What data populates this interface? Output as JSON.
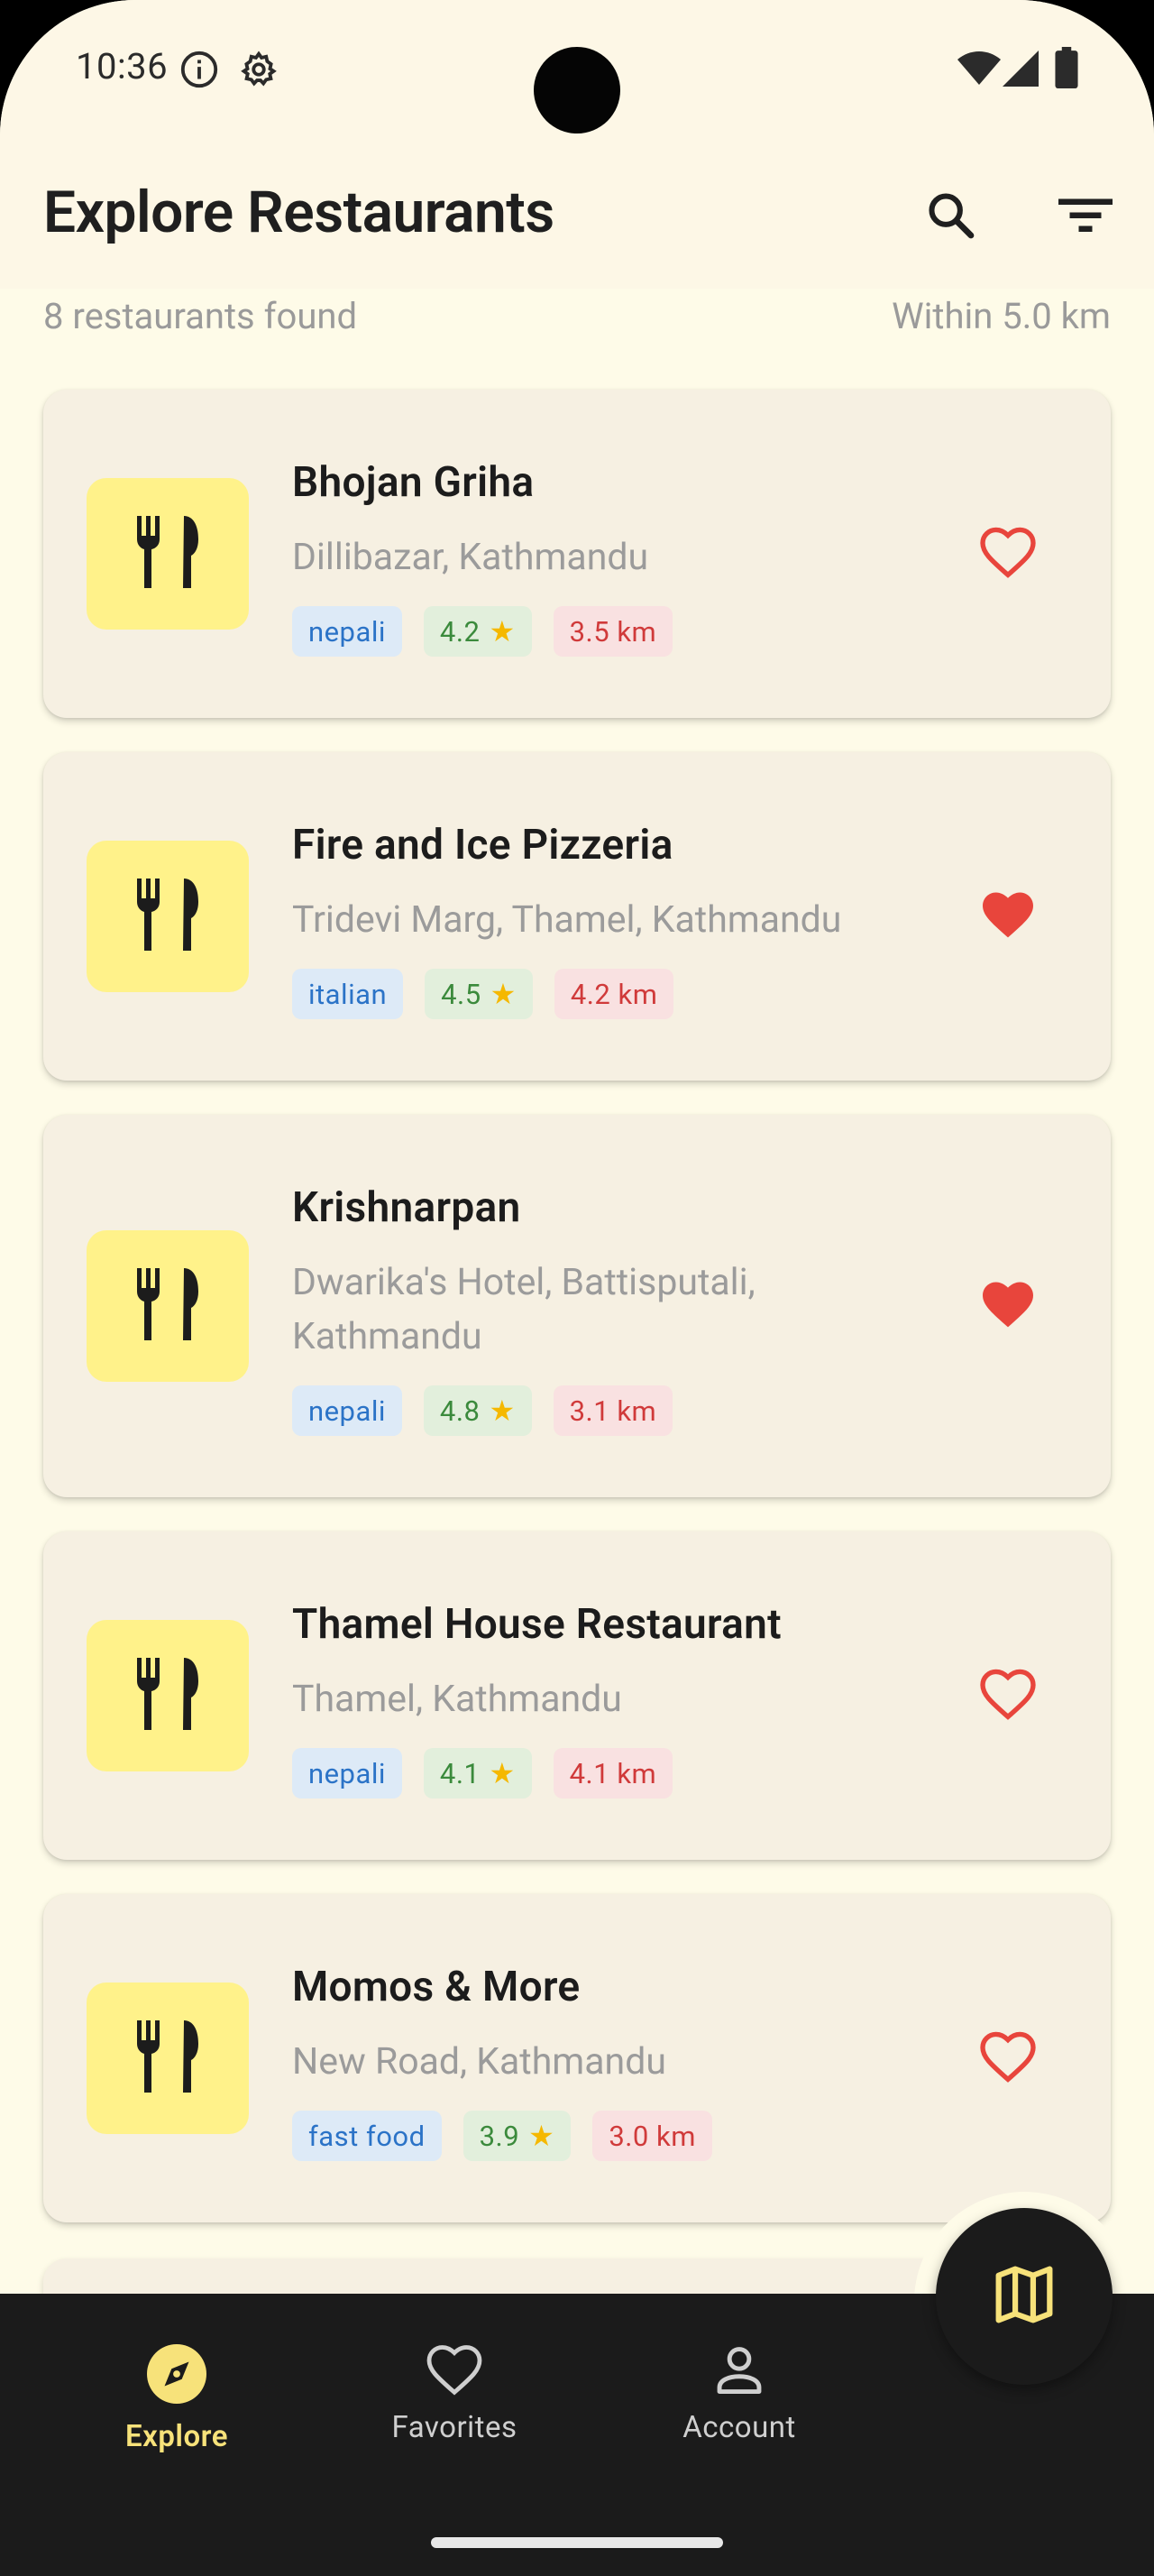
{
  "status_bar": {
    "time": "10:36"
  },
  "app_bar": {
    "title": "Explore Restaurants"
  },
  "meta": {
    "count_text": "8 restaurants found",
    "radius_text": "Within 5.0 km"
  },
  "colors": {
    "background": "#fefbe8",
    "card": "#f6f0e2",
    "thumb": "#fff28a",
    "accent_yellow": "#f7e27a",
    "favorite_red": "#e8453c",
    "nav_bar": "#1b1b1b"
  },
  "restaurants": [
    {
      "name": "Bhojan Griha",
      "address": "Dillibazar, Kathmandu",
      "cuisine": "nepali",
      "rating": "4.2",
      "distance": "3.5 km",
      "favorite": false
    },
    {
      "name": "Fire and Ice Pizzeria",
      "address": "Tridevi Marg, Thamel, Kathmandu",
      "cuisine": "italian",
      "rating": "4.5",
      "distance": "4.2 km",
      "favorite": true
    },
    {
      "name": "Krishnarpan",
      "address": "Dwarika's Hotel, Battisputali, Kathmandu",
      "cuisine": "nepali",
      "rating": "4.8",
      "distance": "3.1 km",
      "favorite": true
    },
    {
      "name": "Thamel House Restaurant",
      "address": "Thamel, Kathmandu",
      "cuisine": "nepali",
      "rating": "4.1",
      "distance": "4.1 km",
      "favorite": false
    },
    {
      "name": "Momos & More",
      "address": "New Road, Kathmandu",
      "cuisine": "fast food",
      "rating": "3.9",
      "distance": "3.0 km",
      "favorite": false
    }
  ],
  "bottom_nav": {
    "items": [
      {
        "label": "Explore",
        "icon": "compass-icon",
        "active": true
      },
      {
        "label": "Favorites",
        "icon": "heart-outline-icon",
        "active": false
      },
      {
        "label": "Account",
        "icon": "person-icon",
        "active": false
      }
    ],
    "fab_icon": "map-icon"
  }
}
